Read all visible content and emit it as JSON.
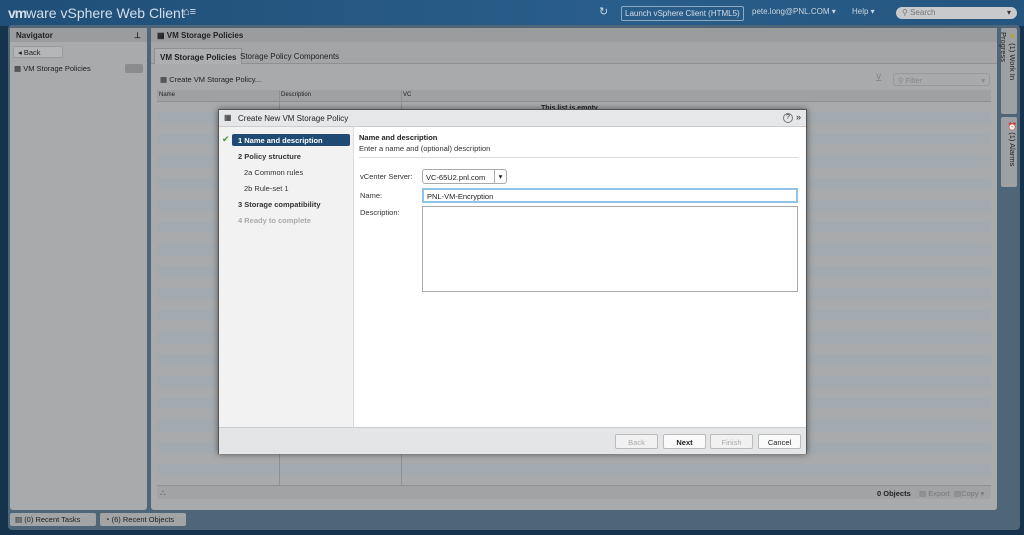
{
  "header": {
    "brand_vm": "vm",
    "brand_ware": "ware",
    "product": "vSphere Web Client",
    "home_icon": "home-menu-icon",
    "refresh_icon": "refresh-icon",
    "launch": "Launch vSphere Client (HTML5)",
    "user": "pete.long@PNL.COM ▾",
    "help": "Help ▾",
    "search_placeholder": "Search"
  },
  "navigator": {
    "title": "Navigator",
    "back": "Back",
    "item": "VM Storage Policies"
  },
  "main": {
    "title": "VM Storage Policies",
    "tabs": [
      {
        "label": "VM Storage Policies",
        "active": true
      },
      {
        "label": "Storage Policy Components",
        "active": false
      }
    ],
    "create": "Create VM Storage Policy...",
    "filter_placeholder": "Filter",
    "columns": [
      "Name",
      "Description",
      "VC"
    ],
    "empty": "This list is empty.",
    "objects": "0 Objects",
    "export": "Export",
    "copy": "Copy ▾"
  },
  "right_sidebar": {
    "work": "(1)  Work In Progress",
    "alarms": "(1)  Alarms"
  },
  "bottom": {
    "tasks": "(0)  Recent Tasks",
    "objects": "(6)  Recent Objects"
  },
  "dialog": {
    "title": "Create New VM Storage Policy",
    "help": "?",
    "expand": "»",
    "steps": [
      {
        "label": "1  Name and description",
        "state": "selected"
      },
      {
        "label": "2  Policy structure",
        "state": "normal"
      },
      {
        "label": "2a  Common rules",
        "state": "sub"
      },
      {
        "label": "2b  Rule-set 1",
        "state": "sub"
      },
      {
        "label": "3  Storage compatibility",
        "state": "normal"
      },
      {
        "label": "4  Ready to complete",
        "state": "disabled"
      }
    ],
    "section_title": "Name and description",
    "section_sub": "Enter a name and (optional) description",
    "vcenter_label": "vCenter Server:",
    "vcenter_value": "VC-65U2.pnl.com",
    "name_label": "Name:",
    "name_value": "PNL-VM-Encryption",
    "desc_label": "Description:",
    "desc_value": "",
    "buttons": {
      "back": "Back",
      "next": "Next",
      "finish": "Finish",
      "cancel": "Cancel"
    }
  },
  "colors": {
    "header": "#2a5e8a",
    "selected_step": "#1f4a73",
    "accent_focus": "#4a9fd8"
  }
}
